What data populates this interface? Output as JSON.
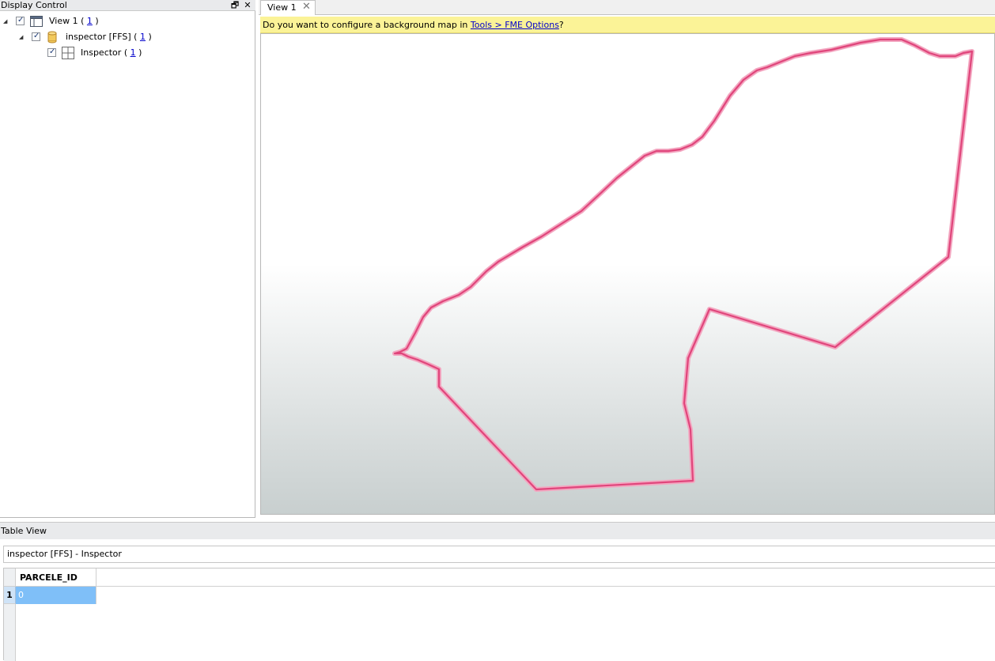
{
  "display_control": {
    "title": "Display Control",
    "restore_glyph": "🗗",
    "close_glyph": "✕",
    "tree": [
      {
        "label": "View 1",
        "open": "(",
        "count": "1",
        "close": ")",
        "icon": "view-window-icon",
        "checked": true,
        "expanded": true
      },
      {
        "label": "inspector [FFS]",
        "open": "(",
        "count": "1",
        "close": ")",
        "icon": "database-cylinder-icon",
        "checked": true,
        "expanded": true
      },
      {
        "label": "Inspector",
        "open": "(",
        "count": "1",
        "close": ")",
        "icon": "grid-feature-type-icon",
        "checked": true,
        "expanded": false
      }
    ],
    "expander_glyph": "◢",
    "check_glyph": "✓"
  },
  "view": {
    "tab_label": "View 1",
    "tab_close_glyph": "✕",
    "notification": {
      "prefix": "Do you want to configure a background map in ",
      "link": "Tools > FME Options",
      "suffix": "?"
    },
    "geometry_color": "#e0457b",
    "geometry_halo_color": "#f3a6c0"
  },
  "table_view": {
    "title": "Table View",
    "source_label": "inspector [FFS] - Inspector",
    "columns": [
      "PARCELE_ID"
    ],
    "rows": [
      {
        "row_number": "1",
        "cells": [
          "0"
        ]
      }
    ],
    "selected_cell_color": "#7fbff8"
  }
}
